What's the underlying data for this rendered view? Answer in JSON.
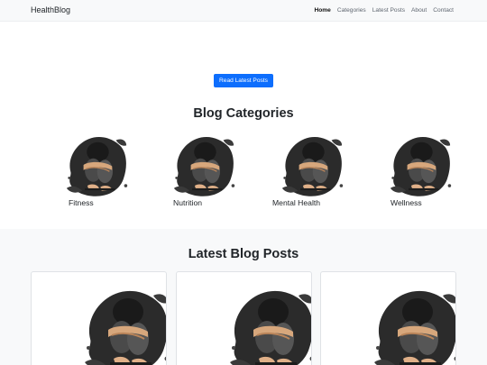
{
  "navbar": {
    "brand": "HealthBlog",
    "links": [
      "Home",
      "Categories",
      "Latest Posts",
      "About",
      "Contact"
    ],
    "active": "Home"
  },
  "hero": {
    "button_label": "Read Latest Posts"
  },
  "categories": {
    "title": "Blog Categories",
    "items": [
      {
        "label": "Fitness"
      },
      {
        "label": "Nutrition"
      },
      {
        "label": "Mental Health"
      },
      {
        "label": "Wellness"
      }
    ]
  },
  "latest": {
    "title": "Latest Blog Posts",
    "posts": 3
  },
  "colors": {
    "primary": "#0d6efd",
    "section_bg": "#f8f9fa",
    "navbar_bg": "#f8f9fa"
  },
  "image_subject": "figure-hugging-knees"
}
